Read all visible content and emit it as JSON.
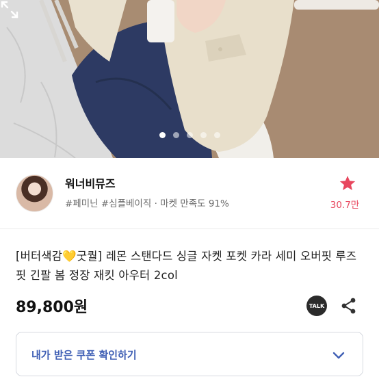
{
  "gallery": {
    "slides_total": 5,
    "active_slide": 1
  },
  "seller": {
    "name": "워너비뮤즈",
    "tags": "#페미닌 #심플베이직 · 마켓 만족도 91%",
    "likes": "30.7만"
  },
  "product": {
    "title": "[버터색감💛굿퀄] 레몬 스탠다드 싱글 자켓 포켓 카라 세미 오버핏 루즈핏 긴팔 봄 정장 재킷 아우터 2col",
    "price": "89,800원"
  },
  "actions": {
    "talk_label": "TALK"
  },
  "coupon": {
    "label": "내가 받은 쿠폰 확인하기"
  },
  "colors": {
    "accent_pink": "#e8475e",
    "coupon_blue": "#3f5fb5"
  },
  "icons": [
    "expand-icon",
    "star-icon",
    "talk-icon",
    "share-icon",
    "chevron-down-icon"
  ]
}
